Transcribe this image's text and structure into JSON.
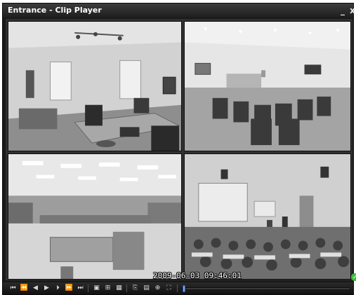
{
  "window": {
    "title": "Entrance - Clip Player",
    "minimize_glyph": "_",
    "close_glyph": "x"
  },
  "overlay": {
    "timestamp": "2009-06-03 09:46:01",
    "status_icon": "check-icon",
    "status_glyph": "✓",
    "status_color": "#3cbf3c"
  },
  "cameras": [
    {
      "name": "camera-1-office"
    },
    {
      "name": "camera-2-classroom"
    },
    {
      "name": "camera-3-store"
    },
    {
      "name": "camera-4-auditorium"
    }
  ],
  "toolbar": {
    "buttons": [
      {
        "name": "go-to-start-button",
        "icon": "skip-start-icon",
        "glyph": "⏮"
      },
      {
        "name": "fast-rewind-button",
        "icon": "fast-rewind-icon",
        "glyph": "⏪"
      },
      {
        "name": "step-back-button",
        "icon": "step-back-icon",
        "glyph": "◀"
      },
      {
        "name": "play-button",
        "icon": "play-icon",
        "glyph": "▶"
      },
      {
        "name": "step-forward-button",
        "icon": "step-forward-icon",
        "glyph": "⏵"
      },
      {
        "name": "fast-forward-button",
        "icon": "fast-forward-icon",
        "glyph": "⏩"
      },
      {
        "name": "go-to-end-button",
        "icon": "skip-end-icon",
        "glyph": "⏭"
      },
      {
        "name": "single-view-button",
        "icon": "single-view-icon",
        "glyph": "▣"
      },
      {
        "name": "quad-view-button",
        "icon": "quad-grid-icon",
        "glyph": "⊞"
      },
      {
        "name": "multi-view-button",
        "icon": "multi-view-icon",
        "glyph": "▦"
      },
      {
        "name": "export-button",
        "icon": "export-icon",
        "glyph": "⎘"
      },
      {
        "name": "save-button",
        "icon": "save-icon",
        "glyph": "▤"
      },
      {
        "name": "zoom-button",
        "icon": "zoom-icon",
        "glyph": "⊕"
      },
      {
        "name": "fullscreen-button",
        "icon": "fullscreen-icon",
        "glyph": "⛶"
      }
    ],
    "seek_progress": 0.01
  }
}
